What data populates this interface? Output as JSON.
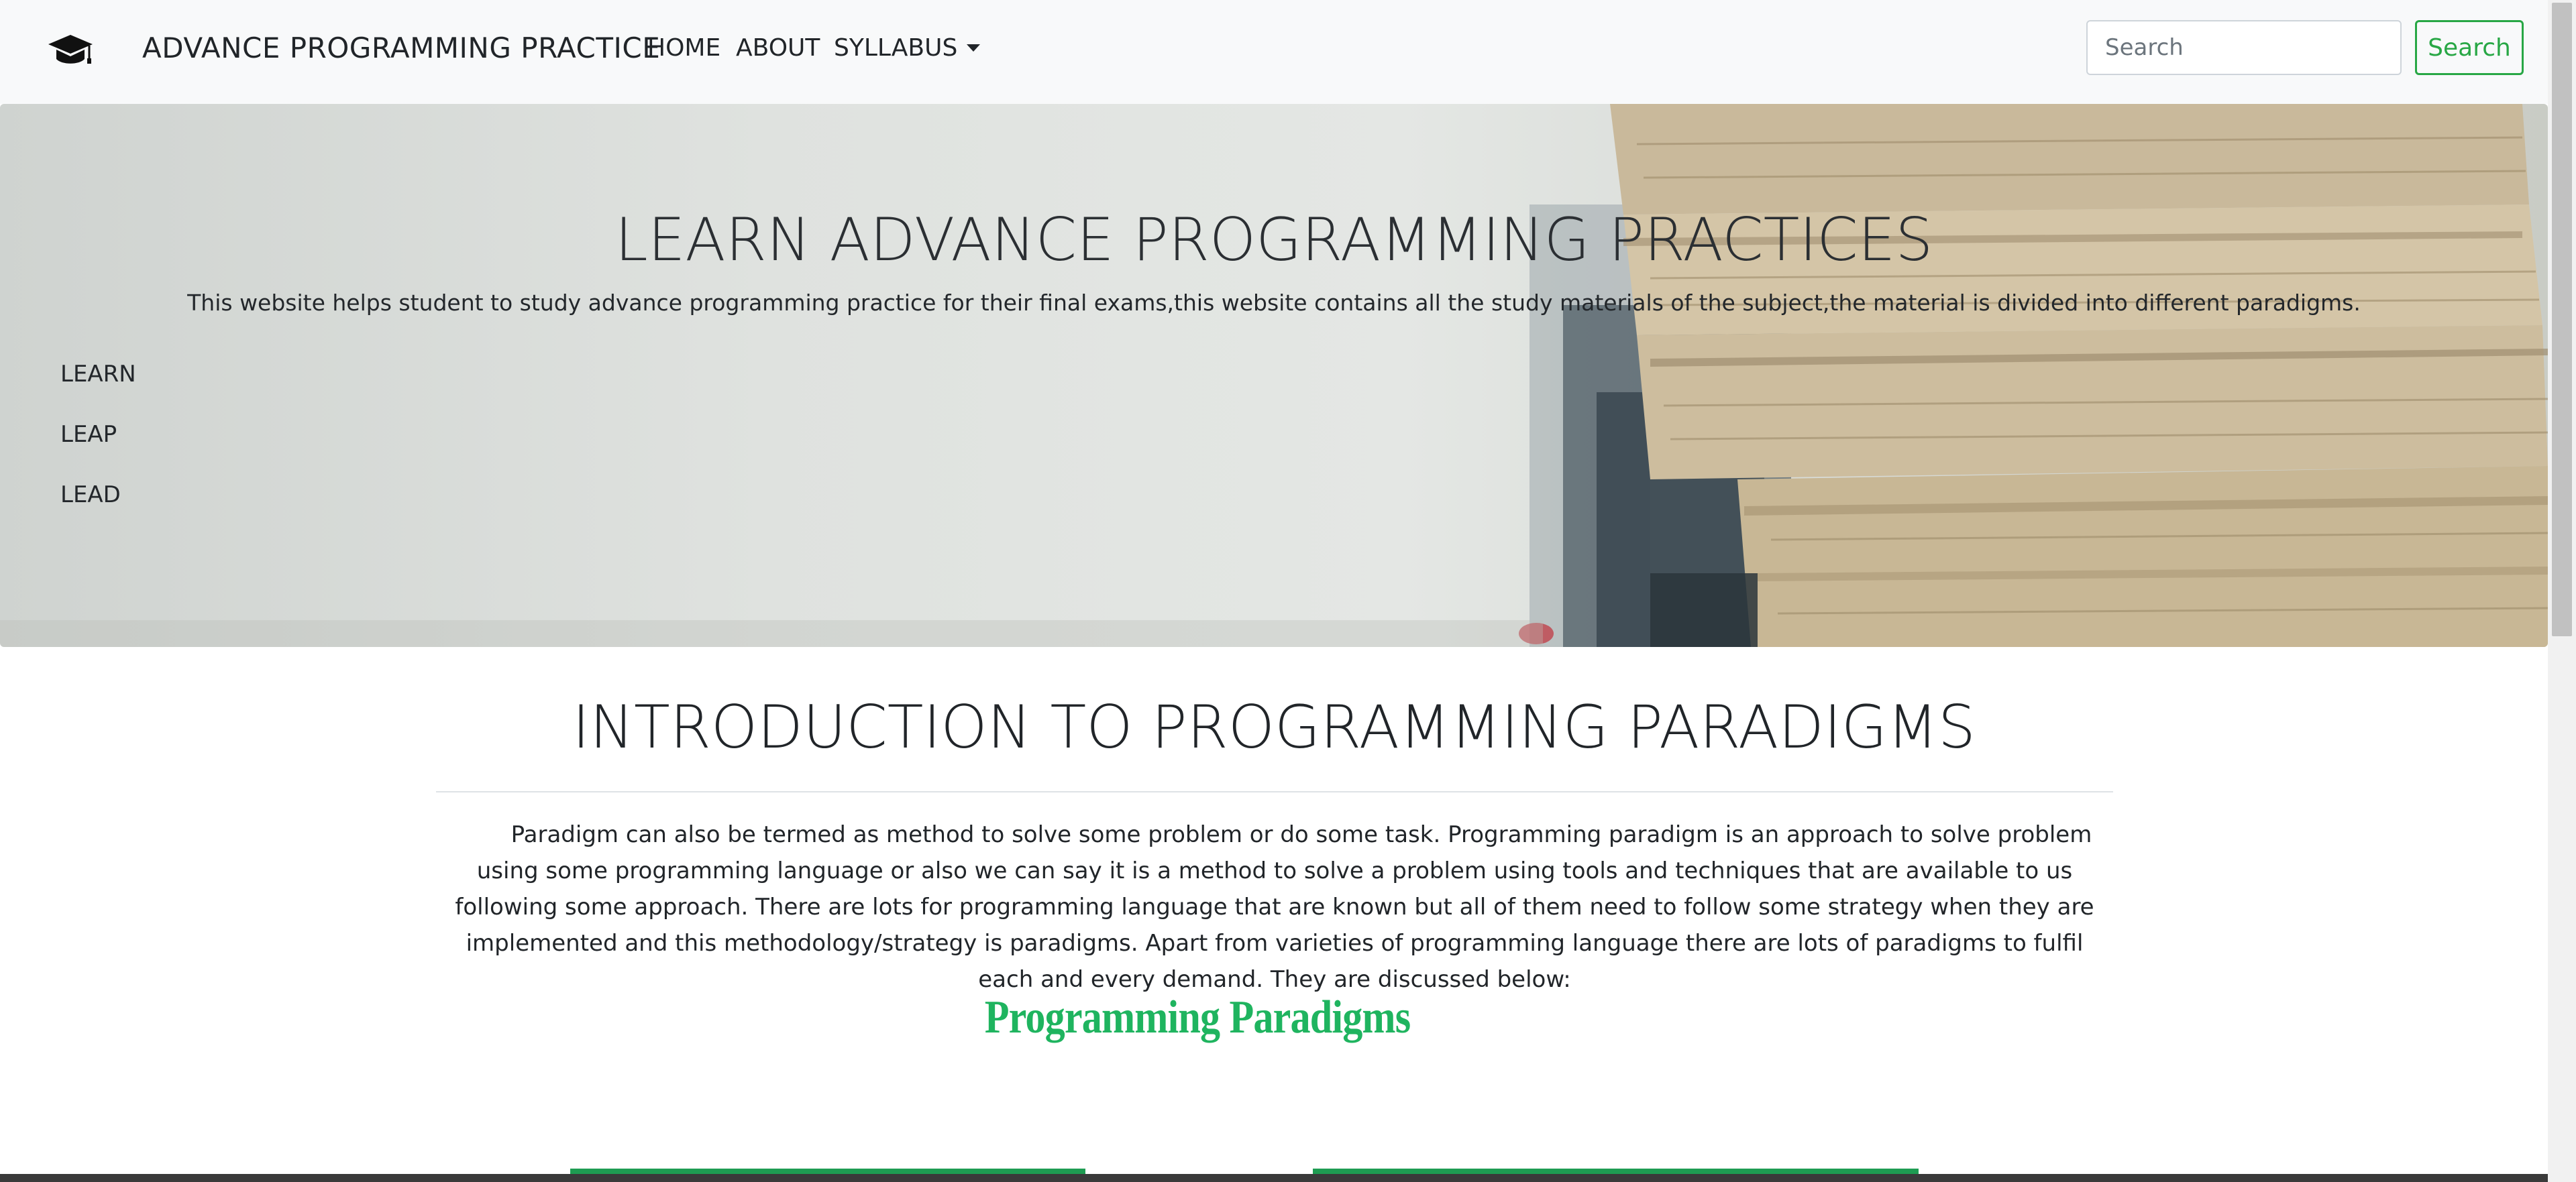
{
  "navbar": {
    "brand": "ADVANCE PROGRAMMING PRACTICE",
    "brand_icon": "graduation-cap-icon",
    "links": [
      {
        "label": "HOME"
      },
      {
        "label": "ABOUT"
      },
      {
        "label": "SYLLABUS"
      }
    ],
    "search": {
      "placeholder": "Search",
      "button_label": "Search"
    }
  },
  "hero": {
    "title": "LEARN ADVANCE PROGRAMMING PRACTICES",
    "subtitle": "This website helps student to study advance programming practice for their final exams,this website contains all the study materials of the subject,the material is divided into different paradigms.",
    "side_items": [
      "LEARN",
      "LEAP",
      "LEAD"
    ]
  },
  "intro": {
    "title": "INTRODUCTION TO PROGRAMMING PARADIGMS",
    "paragraph": "Paradigm can also be termed as method to solve some problem or do some task. Programming paradigm is an approach to solve problem using some programming language or also we can say it is a method to solve a problem using tools and techniques that are available to us following some approach. There are lots for programming language that are known but all of them need to follow some strategy when they are implemented and this methodology/strategy is paradigms. Apart from varieties of programming language there are lots of paradigms to fulfil each and every demand. They are discussed below:",
    "section_heading": "Programming Paradigms"
  },
  "colors": {
    "accent_green": "#28a745",
    "heading_green": "#1fb45f",
    "navbar_bg": "#f8f9fa"
  }
}
